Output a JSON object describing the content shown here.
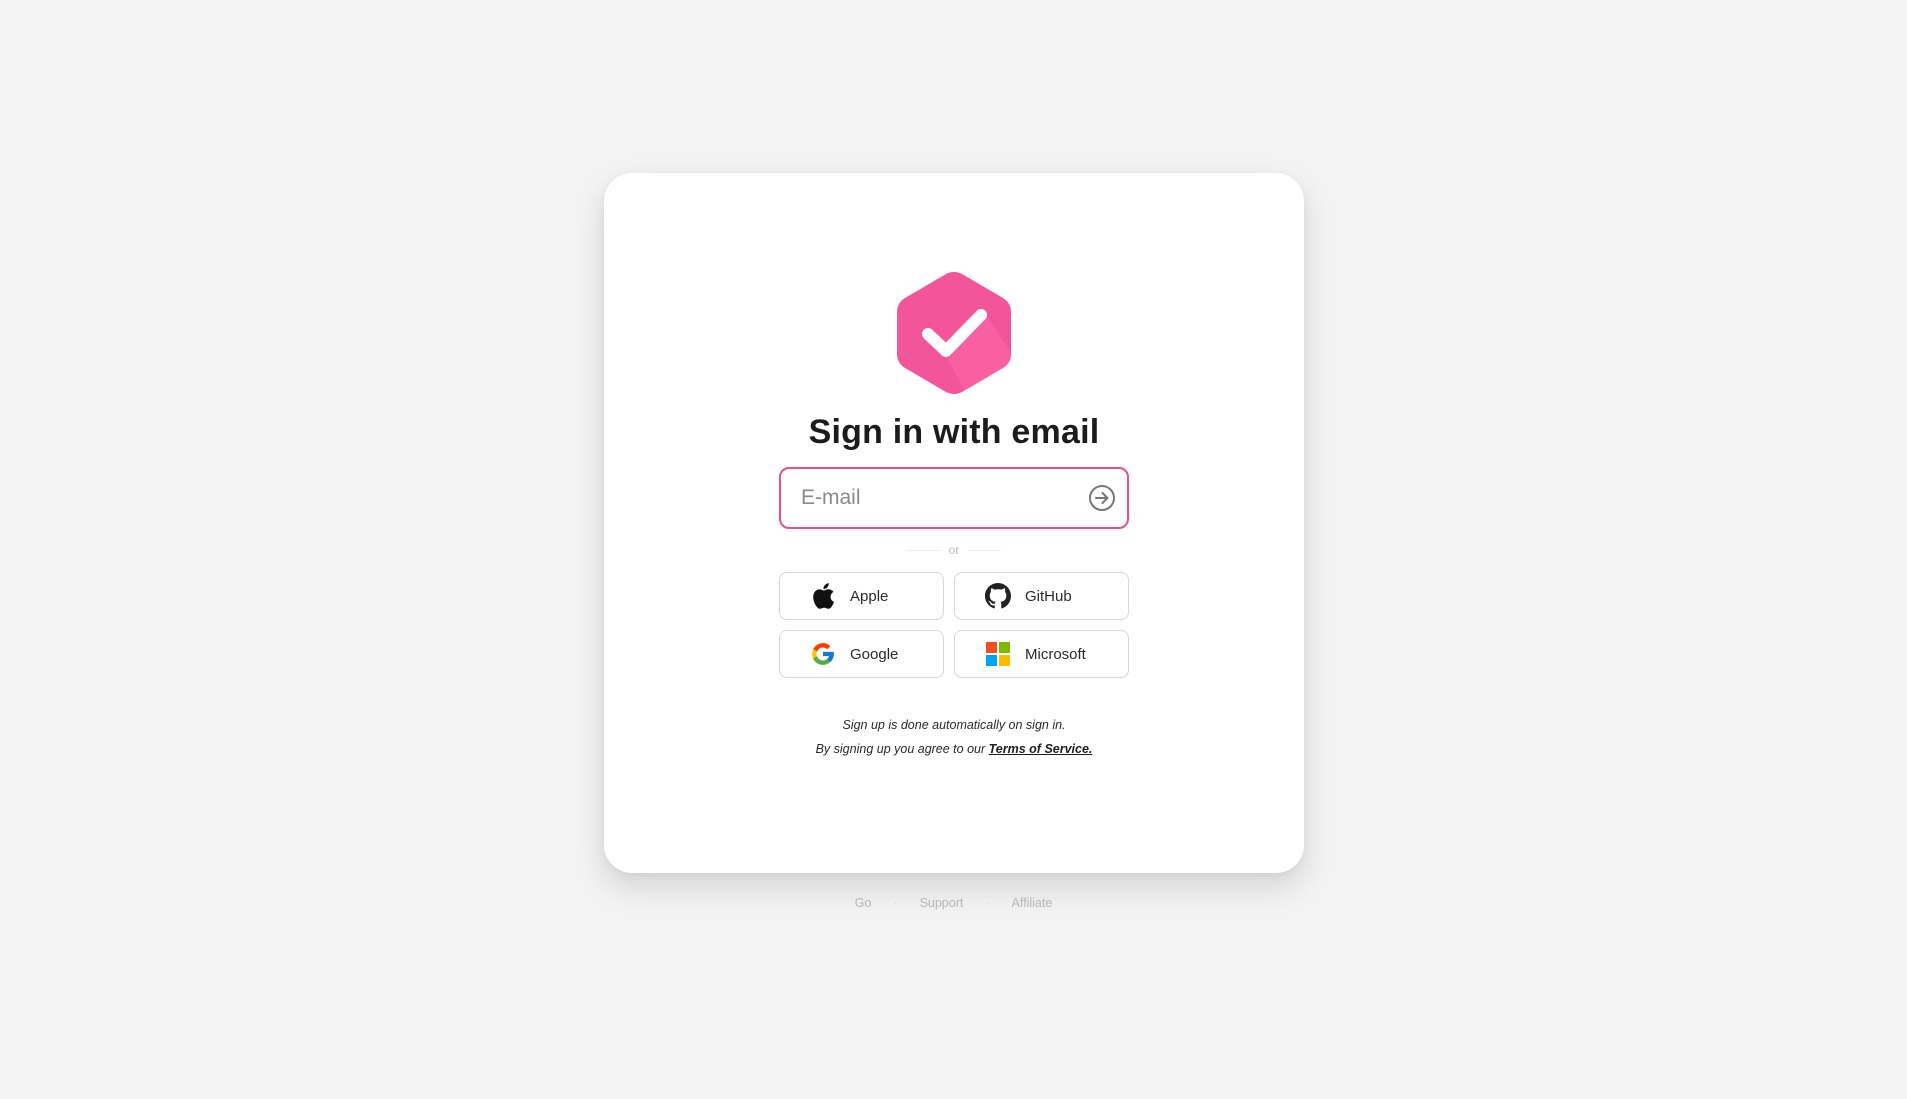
{
  "login": {
    "title": "Sign in with email",
    "email_placeholder": "E-mail",
    "email_value": "",
    "divider_text": "or",
    "providers": [
      {
        "label": "Apple",
        "icon": "apple-icon"
      },
      {
        "label": "GitHub",
        "icon": "github-icon"
      },
      {
        "label": "Google",
        "icon": "google-icon"
      },
      {
        "label": "Microsoft",
        "icon": "microsoft-icon"
      }
    ],
    "note_signup": "Sign up is done automatically on sign in.",
    "note_terms_prefix": "By signing up you agree to our",
    "terms_link": "Terms of Service."
  },
  "footer": {
    "links": [
      "Go",
      "Support",
      "Affiliate"
    ]
  },
  "colors": {
    "page_background": "#f3f3f3",
    "accent": "#e8508f",
    "logo_pink": "#f25599"
  },
  "icons": {
    "logo": "pink-hexagon-checkmark-icon",
    "submit": "arrow-right-circle-icon"
  }
}
